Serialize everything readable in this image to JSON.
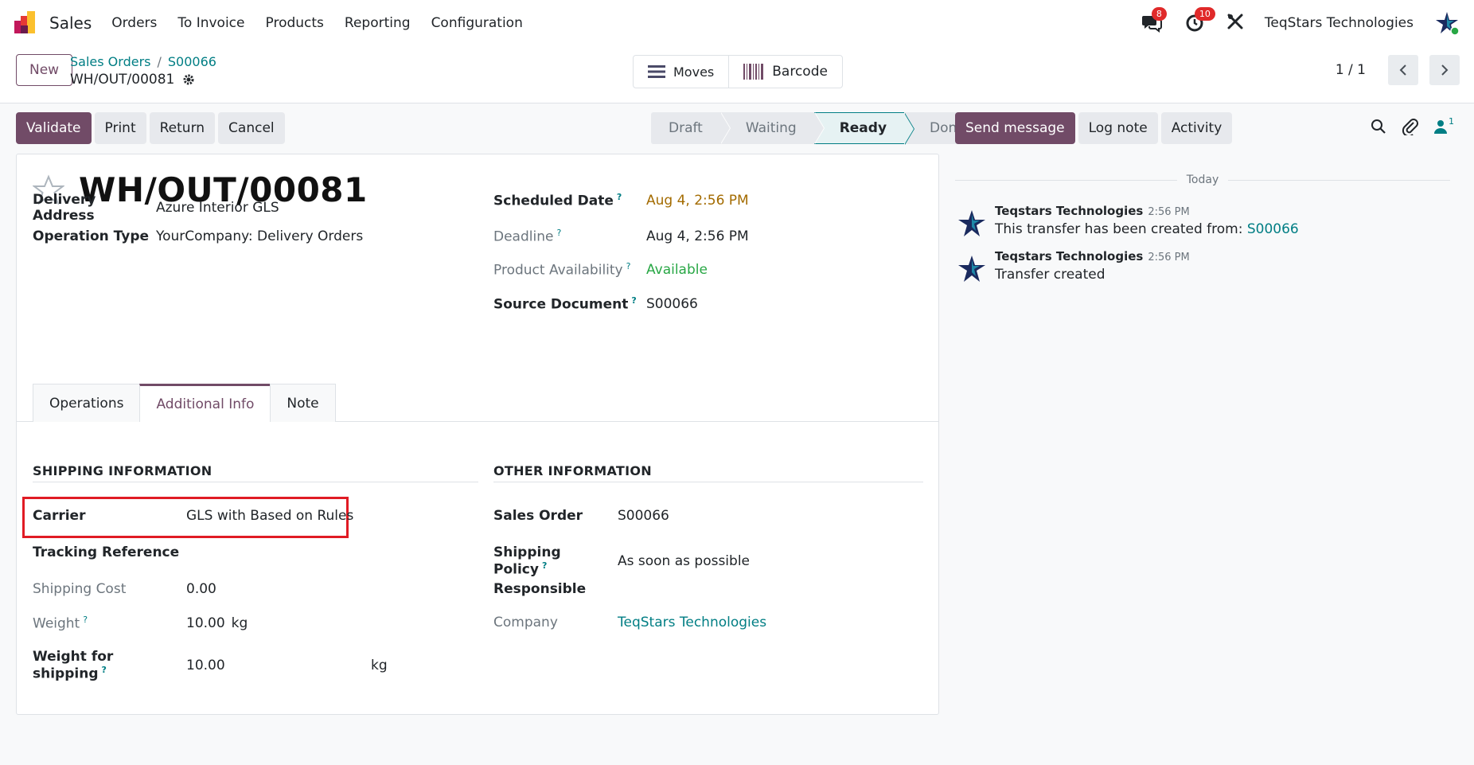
{
  "navbar": {
    "app_name": "Sales",
    "menu": [
      "Orders",
      "To Invoice",
      "Products",
      "Reporting",
      "Configuration"
    ],
    "messages_badge": "8",
    "activities_badge": "10",
    "company": "TeqStars Technologies"
  },
  "control": {
    "new_label": "New",
    "breadcrumb": [
      "Sales Orders",
      "S00066"
    ],
    "record_name": "WH/OUT/00081",
    "smart_buttons": {
      "moves": "Moves",
      "barcode": "Barcode"
    },
    "pager": "1 / 1"
  },
  "actions": [
    "Validate",
    "Print",
    "Return",
    "Cancel"
  ],
  "status": {
    "stages": [
      "Draft",
      "Waiting",
      "Ready",
      "Done"
    ],
    "active": "Ready"
  },
  "form": {
    "title": "WH/OUT/00081",
    "delivery_address": {
      "label": "Delivery Address",
      "value": "Azure Interior GLS"
    },
    "operation_type": {
      "label": "Operation Type",
      "value": "YourCompany: Delivery Orders"
    },
    "scheduled_date": {
      "label": "Scheduled Date",
      "value": "Aug 4, 2:56 PM"
    },
    "deadline": {
      "label": "Deadline",
      "value": "Aug 4, 2:56 PM"
    },
    "product_availability": {
      "label": "Product Availability",
      "value": "Available"
    },
    "source_document": {
      "label": "Source Document",
      "value": "S00066"
    },
    "tabs": [
      "Operations",
      "Additional Info",
      "Note"
    ],
    "active_tab": "Additional Info",
    "qmark": "?",
    "shipping": {
      "title": "SHIPPING INFORMATION",
      "carrier": {
        "label": "Carrier",
        "value": "GLS with Based on Rules"
      },
      "tracking_reference": {
        "label": "Tracking Reference",
        "value": ""
      },
      "shipping_cost": {
        "label": "Shipping Cost",
        "value": "0.00"
      },
      "weight": {
        "label": "Weight",
        "value": "10.00",
        "unit": "kg"
      },
      "weight_for_shipping": {
        "label": "Weight for shipping",
        "value": "10.00",
        "unit": "kg"
      }
    },
    "other": {
      "title": "OTHER INFORMATION",
      "sales_order": {
        "label": "Sales Order",
        "value": "S00066"
      },
      "shipping_policy": {
        "label": "Shipping Policy",
        "value": "As soon as possible"
      },
      "responsible": {
        "label": "Responsible",
        "value": ""
      },
      "company": {
        "label": "Company",
        "value": "TeqStars Technologies"
      }
    }
  },
  "chatter": {
    "buttons": [
      "Send message",
      "Log note",
      "Activity"
    ],
    "followers_count": "1",
    "date_separator": "Today",
    "messages": [
      {
        "author": "Teqstars Technologies",
        "time": "2:56 PM",
        "text": "This transfer has been created from: ",
        "link": "S00066"
      },
      {
        "author": "Teqstars Technologies",
        "time": "2:56 PM",
        "text": "Transfer created",
        "link": ""
      }
    ]
  },
  "colors": {
    "primary": "#714b67",
    "link": "#017e84",
    "highlight": "#e01b24",
    "warning": "#a36b00",
    "success": "#28a745"
  }
}
